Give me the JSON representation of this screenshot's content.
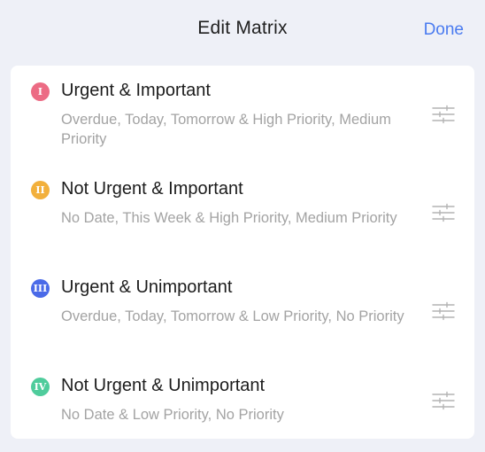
{
  "header": {
    "title": "Edit Matrix",
    "done_label": "Done"
  },
  "colors": {
    "accent": "#4a7bf0",
    "badge_1": "#ec6b84",
    "badge_2": "#f2b03c",
    "badge_3": "#4a6ae8",
    "badge_4": "#4fcc9c"
  },
  "quadrants": [
    {
      "numeral": "I",
      "title": "Urgent & Important",
      "description": "Overdue, Today, Tomorrow & High Priority, Medium Priority",
      "icon": "sliders-icon"
    },
    {
      "numeral": "II",
      "title": "Not Urgent & Important",
      "description": "No Date, This Week & High Priority, Medium Priority",
      "icon": "sliders-icon"
    },
    {
      "numeral": "III",
      "title": "Urgent & Unimportant",
      "description": "Overdue, Today, Tomorrow & Low Priority, No Priority",
      "icon": "sliders-icon"
    },
    {
      "numeral": "IV",
      "title": "Not Urgent & Unimportant",
      "description": "No Date & Low Priority, No Priority",
      "icon": "sliders-icon"
    }
  ]
}
